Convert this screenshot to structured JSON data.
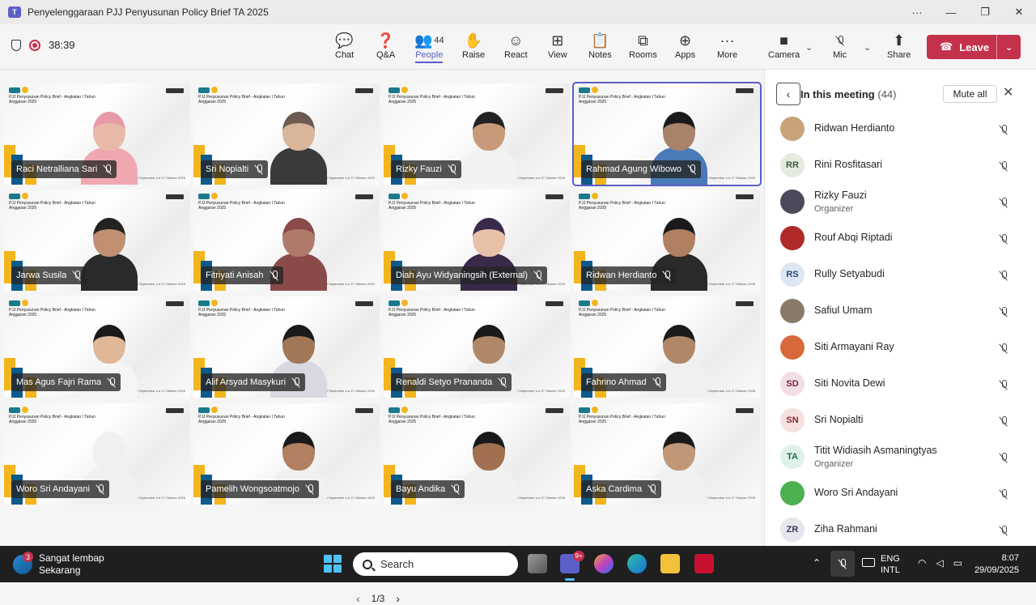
{
  "window": {
    "title": "Penyelenggaraan PJJ Penyusunan Policy Brief TA 2025",
    "app_icon": "teams-icon",
    "controls": [
      "···",
      "—",
      "❐",
      "✕"
    ]
  },
  "toolbar": {
    "timer": "38:39",
    "buttons": [
      {
        "id": "chat",
        "label": "Chat",
        "icon": "chat-icon"
      },
      {
        "id": "qa",
        "label": "Q&A",
        "icon": "qa-icon"
      },
      {
        "id": "people",
        "label": "People",
        "icon": "people-icon",
        "count": "44",
        "active": true
      },
      {
        "id": "raise",
        "label": "Raise",
        "icon": "hand-icon"
      },
      {
        "id": "react",
        "label": "React",
        "icon": "smiley-icon"
      },
      {
        "id": "view",
        "label": "View",
        "icon": "grid-icon"
      },
      {
        "id": "notes",
        "label": "Notes",
        "icon": "notes-icon"
      },
      {
        "id": "rooms",
        "label": "Rooms",
        "icon": "rooms-icon"
      },
      {
        "id": "apps",
        "label": "Apps",
        "icon": "plus-icon"
      },
      {
        "id": "more",
        "label": "More",
        "icon": "ellipsis-icon"
      },
      {
        "id": "camera",
        "label": "Camera",
        "icon": "camera-icon"
      },
      {
        "id": "mic",
        "label": "Mic",
        "icon": "mic-off-icon"
      },
      {
        "id": "share",
        "label": "Share",
        "icon": "share-icon"
      }
    ],
    "leave_label": "Leave"
  },
  "stage": {
    "slide_header": "PJJ Penyusunan Policy Brief - Angkatan I Tahun Anggaran 2025",
    "slide_date": "29 September s.d 17 Oktober 2025",
    "tiles": [
      {
        "name": "Raci Netralliana Sari",
        "skin": "#e8b8a8",
        "cloth": "#f0a8b0",
        "hair": "#e89aa8",
        "speaking": false
      },
      {
        "name": "Sri Nopialti",
        "skin": "#d9b59a",
        "cloth": "#3a3a3a",
        "hair": "#6b5b52",
        "speaking": false
      },
      {
        "name": "Rizky Fauzi",
        "skin": "#c89a7a",
        "cloth": "#f2f2f2",
        "hair": "#222222",
        "speaking": false
      },
      {
        "name": "Rahmad Agung Wibowo",
        "skin": "#a9826a",
        "cloth": "#4a7ab8",
        "hair": "#1a1a1a",
        "speaking": true
      },
      {
        "name": "Jarwa Susila",
        "skin": "#c09070",
        "cloth": "#2a2a2a",
        "hair": "#222222",
        "speaking": false
      },
      {
        "name": "Fitriyati Anisah",
        "skin": "#b07a6a",
        "cloth": "#8a4a4a",
        "hair": "#8a4a4a",
        "speaking": false
      },
      {
        "name": "Diah Ayu Widyaningsih (External)",
        "skin": "#e8c0a8",
        "cloth": "#3a2a4a",
        "hair": "#3a2a4a",
        "speaking": false
      },
      {
        "name": "Ridwan Herdianto",
        "skin": "#b08060",
        "cloth": "#2a2a2a",
        "hair": "#1a1a1a",
        "speaking": false
      },
      {
        "name": "Mas Agus Fajri Rama",
        "skin": "#e0b898",
        "cloth": "#f5f5f5",
        "hair": "#1a1a1a",
        "speaking": false
      },
      {
        "name": "Alif Arsyad Masykuri",
        "skin": "#a07858",
        "cloth": "#d8d8e0",
        "hair": "#1a1a1a",
        "speaking": false
      },
      {
        "name": "Renaldi Setyo Prananda",
        "skin": "#b08868",
        "cloth": "#f0f0f0",
        "hair": "#1a1a1a",
        "speaking": false
      },
      {
        "name": "Fahrino Ahmad",
        "skin": "#b08868",
        "cloth": "#f0f0f0",
        "hair": "#1a1a1a",
        "speaking": false
      },
      {
        "name": "Woro Sri Andayani",
        "skin": "#f0f0f0",
        "cloth": "#f0f0f0",
        "hair": "#f0f0f0",
        "speaking": false
      },
      {
        "name": "Pamelih Wongsoatmojo",
        "skin": "#b08060",
        "cloth": "#f0f0f0",
        "hair": "#1a1a1a",
        "speaking": false
      },
      {
        "name": "Bayu Andika",
        "skin": "#a07050",
        "cloth": "#f0f0f0",
        "hair": "#1a1a1a",
        "speaking": false
      },
      {
        "name": "Aska Cardima",
        "skin": "#c09878",
        "cloth": "#f0f0f0",
        "hair": "#1a1a1a",
        "speaking": false
      }
    ],
    "pager": "1/3"
  },
  "panel": {
    "title": "In this meeting",
    "count": "(44)",
    "mute_all_label": "Mute all",
    "participants": [
      {
        "name": "Ridwan Herdianto",
        "role": "",
        "initials": "",
        "avatar_bg": "#c9a27a",
        "avatar_fg": "#fff"
      },
      {
        "name": "Rini Rosfitasari",
        "role": "",
        "initials": "RR",
        "avatar_bg": "#e3ecdf",
        "avatar_fg": "#3a5a3a"
      },
      {
        "name": "Rizky Fauzi",
        "role": "Organizer",
        "initials": "",
        "avatar_bg": "#4a4a5a",
        "avatar_fg": "#fff"
      },
      {
        "name": "Rouf Abqi Riptadi",
        "role": "",
        "initials": "",
        "avatar_bg": "#b02a2a",
        "avatar_fg": "#fff"
      },
      {
        "name": "Rully Setyabudi",
        "role": "",
        "initials": "RS",
        "avatar_bg": "#dde6f2",
        "avatar_fg": "#2a4a7a"
      },
      {
        "name": "Safiul Umam",
        "role": "",
        "initials": "",
        "avatar_bg": "#8a7a6a",
        "avatar_fg": "#fff"
      },
      {
        "name": "Siti Armayani Ray",
        "role": "",
        "initials": "",
        "avatar_bg": "#d8683a",
        "avatar_fg": "#fff"
      },
      {
        "name": "Siti Novita Dewi",
        "role": "",
        "initials": "SD",
        "avatar_bg": "#f2dfe6",
        "avatar_fg": "#7a2a4a"
      },
      {
        "name": "Sri Nopialti",
        "role": "",
        "initials": "SN",
        "avatar_bg": "#f6e0e0",
        "avatar_fg": "#8a2a2a"
      },
      {
        "name": "Titit Widiasih Asmaningtyas",
        "role": "Organizer",
        "initials": "TA",
        "avatar_bg": "#dff2ea",
        "avatar_fg": "#1a6a4a"
      },
      {
        "name": "Woro Sri Andayani",
        "role": "",
        "initials": "",
        "avatar_bg": "#4caf50",
        "avatar_fg": "#fff"
      },
      {
        "name": "Ziha Rahmani",
        "role": "",
        "initials": "ZR",
        "avatar_bg": "#e6e6ee",
        "avatar_fg": "#3a3a5a"
      }
    ]
  },
  "taskbar": {
    "weather_badge": "3",
    "weather_line1": "Sangat lembap",
    "weather_line2": "Sekarang",
    "search_placeholder": "Search",
    "teams_badge": "9+",
    "lang_line1": "ENG",
    "lang_line2": "INTL",
    "time": "8:07",
    "date": "29/09/2025"
  }
}
